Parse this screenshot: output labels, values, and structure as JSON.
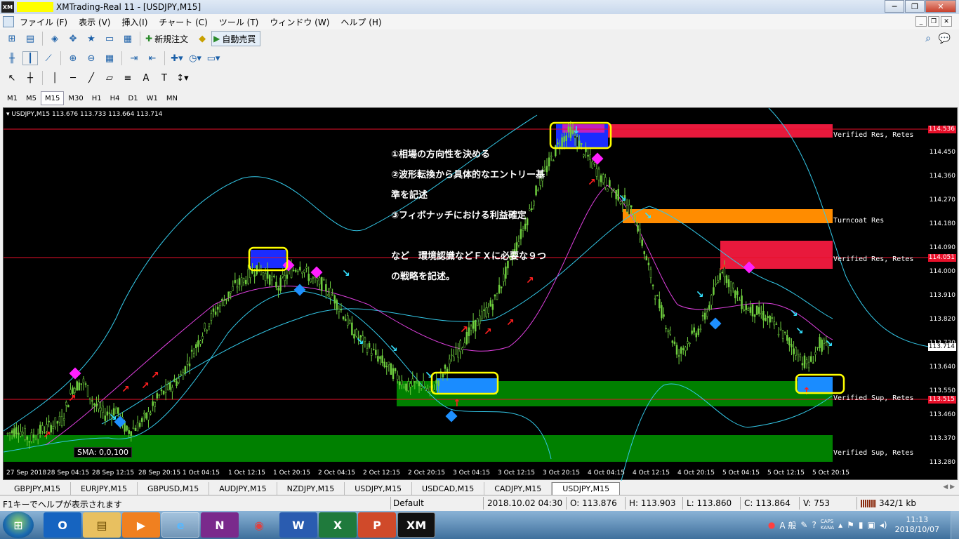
{
  "window": {
    "title": "XMTrading-Real 11 - [USDJPY,M15]",
    "app_icon_text": "XM",
    "controls": [
      "─",
      "❐",
      "✕"
    ]
  },
  "menu": {
    "items": [
      "ファイル (F)",
      "表示 (V)",
      "挿入(I)",
      "チャート (C)",
      "ツール (T)",
      "ウィンドウ (W)",
      "ヘルプ (H)"
    ]
  },
  "toolbar": {
    "new_order_label": "新規注文",
    "auto_trading_label": "自動売買",
    "timeframes": [
      "M1",
      "M5",
      "M15",
      "M30",
      "H1",
      "H4",
      "D1",
      "W1",
      "MN"
    ],
    "active_timeframe": "M15"
  },
  "chart": {
    "header": "USDJPY,M15  113.676 113.733 113.664 113.714",
    "price_ticks": [
      "114.450",
      "114.360",
      "114.270",
      "114.180",
      "114.090",
      "114.000",
      "113.910",
      "113.820",
      "113.730",
      "113.640",
      "113.550",
      "113.460",
      "113.370",
      "113.280"
    ],
    "price_tags": [
      {
        "label": "114.536",
        "color": "#e8102a"
      },
      {
        "label": "114.051",
        "color": "#e8102a"
      },
      {
        "label": "113.714",
        "color": "#ffffff"
      },
      {
        "label": "113.515",
        "color": "#e8102a"
      }
    ],
    "time_ticks": [
      "27 Sep 2018",
      "28 Sep 04:15",
      "28 Sep 12:15",
      "28 Sep 20:15",
      "1 Oct 04:15",
      "1 Oct 12:15",
      "1 Oct 20:15",
      "2 Oct 04:15",
      "2 Oct 12:15",
      "2 Oct 20:15",
      "3 Oct 04:15",
      "3 Oct 12:15",
      "3 Oct 20:15",
      "4 Oct 04:15",
      "4 Oct 12:15",
      "4 Oct 20:15",
      "5 Oct 04:15",
      "5 Oct 12:15",
      "5 Oct 20:15"
    ],
    "zones": [
      {
        "label": "Verified Res, Retes",
        "color": "#e8193c"
      },
      {
        "label": "Turncoat Res",
        "color": "#ff8c00"
      },
      {
        "label": "Verified Res, Retes",
        "color": "#e8193c"
      },
      {
        "label": "Verified Sup, Retes",
        "color": "#008000"
      },
      {
        "label": "Verified Sup, Retes",
        "color": "#008000"
      }
    ],
    "sma_label": "SMA: 0,0,100",
    "annotation": [
      "①相場の方向性を決める",
      "②波形転換から具体的なエントリー基",
      "準を記述",
      "③フィボナッチにおける利益確定",
      "",
      "など　環境認識などＦＸに必要な９つ",
      "の戦略を記述。"
    ]
  },
  "chart_data": {
    "type": "line",
    "title": "USDJPY,M15",
    "series": [
      {
        "name": "",
        "values": [
          113.41,
          113.43,
          113.39,
          113.42,
          113.44,
          113.46,
          113.58,
          113.6,
          113.52,
          113.48,
          113.5,
          113.42,
          113.44,
          113.48,
          113.55,
          113.58,
          113.62,
          113.7,
          113.78,
          113.85,
          113.9,
          113.95,
          113.98,
          114.02,
          113.99,
          113.95,
          114.0,
          114.03,
          113.98,
          113.96,
          113.92,
          113.85,
          113.78,
          113.74,
          113.7,
          113.66,
          113.62,
          113.58,
          113.6,
          113.56,
          113.62,
          113.68,
          113.74,
          113.8,
          113.85,
          113.9,
          114.0,
          114.1,
          114.2,
          114.32,
          114.4,
          114.48,
          114.52,
          114.46,
          114.4,
          114.34,
          114.3,
          114.26,
          114.2,
          114.05,
          113.9,
          113.8,
          113.7,
          113.76,
          113.8,
          113.9,
          114.02,
          113.94,
          113.88,
          113.86,
          113.84,
          113.8,
          113.76,
          113.7,
          113.66,
          113.74,
          113.72
        ]
      }
    ],
    "ylim": [
      113.28,
      114.54
    ],
    "xlabel": "",
    "ylabel": ""
  },
  "symbol_tabs": [
    "GBPJPY,M15",
    "EURJPY,M15",
    "GBPUSD,M15",
    "AUDJPY,M15",
    "NZDJPY,M15",
    "USDJPY,M15",
    "USDCAD,M15",
    "CADJPY,M15",
    "USDJPY,M15"
  ],
  "status": {
    "help": "F1キーでヘルプが表示されます",
    "profile": "Default",
    "datetime": "2018.10.02 04:30",
    "open": "O: 113.876",
    "high": "H: 113.903",
    "low": "L: 113.860",
    "close": "C: 113.864",
    "volume": "V: 753",
    "traffic": "342/1 kb"
  },
  "taskbar": {
    "apps": [
      "Outlook",
      "Explorer",
      "Media",
      "IE",
      "OneNote",
      "Chrome",
      "Word",
      "Excel",
      "PowerPoint",
      "XM"
    ],
    "ime_text": "A 般",
    "caps": "CAPS",
    "kana": "KANA",
    "time": "11:13",
    "date": "2018/10/07"
  }
}
